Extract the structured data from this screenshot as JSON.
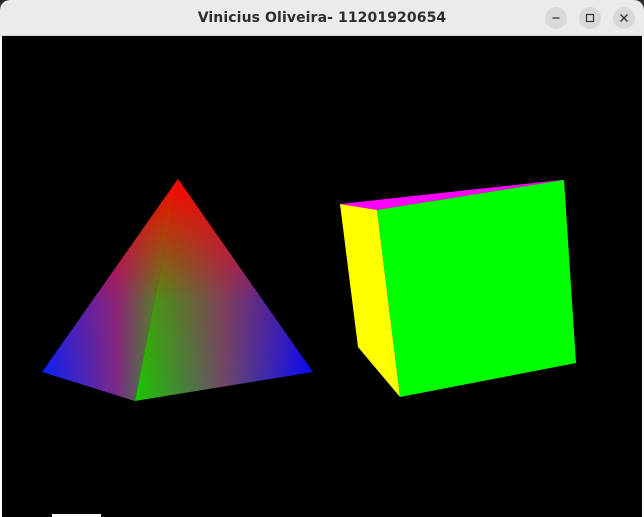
{
  "window": {
    "title": "Vinicius Oliveira- 11201920654",
    "controls": [
      {
        "name": "minimize",
        "icon": "minimize-icon"
      },
      {
        "name": "maximize",
        "icon": "maximize-icon"
      },
      {
        "name": "close",
        "icon": "close-icon"
      }
    ]
  },
  "scene": {
    "background": "#000000",
    "objects": [
      {
        "name": "pyramid",
        "vertex_colors": [
          "#ff0000",
          "#00ff00",
          "#0000ff"
        ]
      },
      {
        "name": "cube",
        "face_colors": {
          "front": "#00ff00",
          "top": "#ff00ff",
          "left": "#ffff00"
        }
      }
    ]
  }
}
